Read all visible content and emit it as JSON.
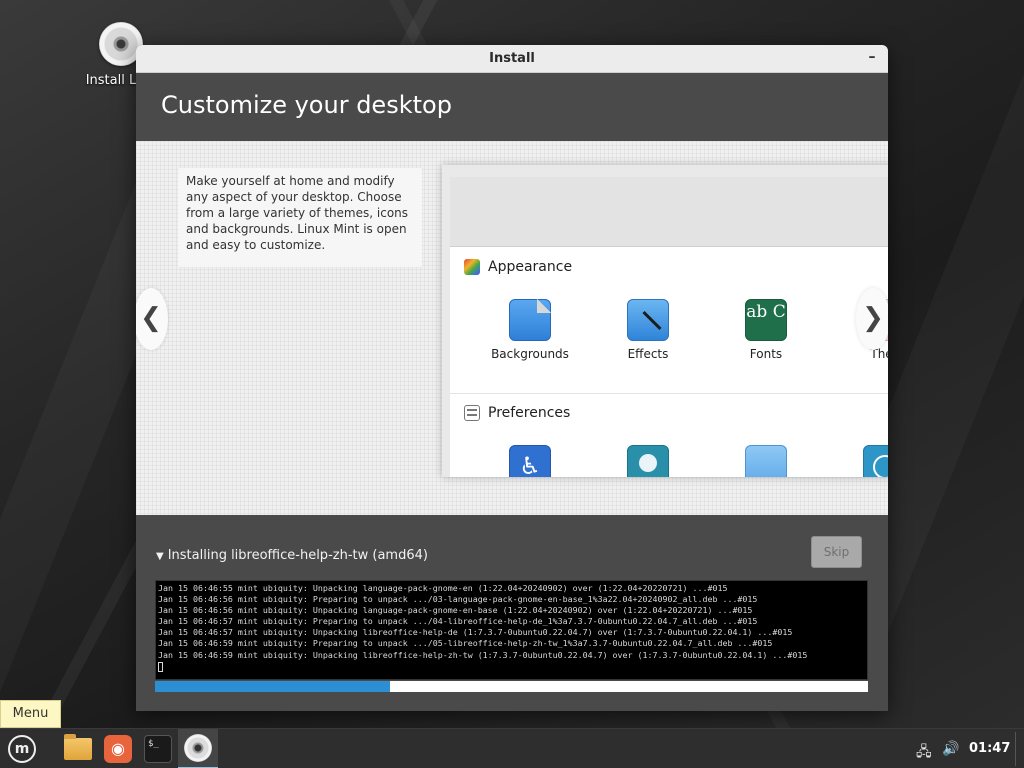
{
  "desktop": {
    "icon_label": "Install Linu"
  },
  "window": {
    "title": "Install",
    "minimize_glyph": "–",
    "header": "Customize your desktop"
  },
  "slide": {
    "description": "Make yourself at home and modify any aspect of your desktop. Choose from a large variety of themes, icons and backgrounds. Linux Mint is open and easy to customize.",
    "prev_glyph": "❮",
    "next_glyph": "❯",
    "appearance_section": "Appearance",
    "preferences_section": "Preferences",
    "appearance_items": [
      {
        "label": "Backgrounds",
        "icon": "backgrounds-icon"
      },
      {
        "label": "Effects",
        "icon": "effects-icon"
      },
      {
        "label": "Fonts",
        "icon": "fonts-icon"
      },
      {
        "label": "Ther",
        "icon": "themes-icon"
      }
    ],
    "fonts_icon_text": "ab C"
  },
  "progress": {
    "status": "Installing libreoffice-help-zh-tw (amd64)",
    "skip_label": "Skip",
    "fraction": 0.33,
    "log": [
      "Jan 15 06:46:55 mint ubiquity: Unpacking language-pack-gnome-en (1:22.04+20240902) over (1:22.04+20220721) ...#015",
      "Jan 15 06:46:56 mint ubiquity: Preparing to unpack .../03-language-pack-gnome-en-base_1%3a22.04+20240902_all.deb ...#015",
      "Jan 15 06:46:56 mint ubiquity: Unpacking language-pack-gnome-en-base (1:22.04+20240902) over (1:22.04+20220721) ...#015",
      "Jan 15 06:46:57 mint ubiquity: Preparing to unpack .../04-libreoffice-help-de_1%3a7.3.7-0ubuntu0.22.04.7_all.deb ...#015",
      "Jan 15 06:46:57 mint ubiquity: Unpacking libreoffice-help-de (1:7.3.7-0ubuntu0.22.04.7) over (1:7.3.7-0ubuntu0.22.04.1) ...#015",
      "Jan 15 06:46:59 mint ubiquity: Preparing to unpack .../05-libreoffice-help-zh-tw_1%3a7.3.7-0ubuntu0.22.04.7_all.deb ...#015",
      "Jan 15 06:46:59 mint ubiquity: Unpacking libreoffice-help-zh-tw (1:7.3.7-0ubuntu0.22.04.7) over (1:7.3.7-0ubuntu0.22.04.1) ...#015"
    ]
  },
  "tooltip": {
    "text": "Menu"
  },
  "taskbar": {
    "clock": "01:47",
    "terminal_icon_text": "$_",
    "firefox_glyph": "◉"
  },
  "colors": {
    "accent": "#2d8fd3",
    "window_bg": "#4a4a4a",
    "tooltip_bg": "#fdf7c4"
  }
}
